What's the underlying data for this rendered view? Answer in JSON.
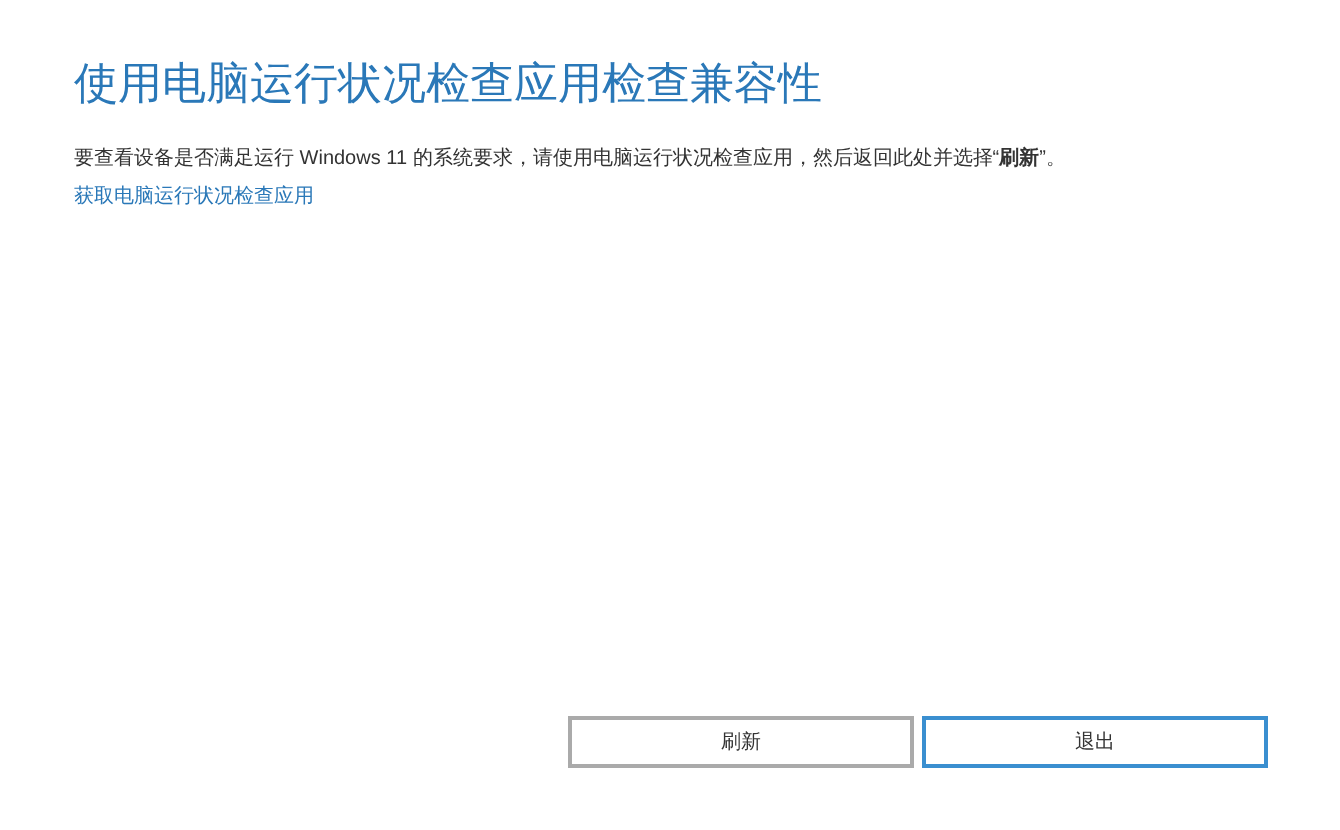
{
  "title": "使用电脑运行状况检查应用检查兼容性",
  "description": {
    "text": "要查看设备是否满足运行 Windows 11 的系统要求，请使用电脑运行状况检查应用，然后返回此处并选择“**刷新**”。",
    "link": "获取电脑运行状况检查应用"
  },
  "buttons": [
    {
      "label": "刷新",
      "focused": false
    },
    {
      "label": "退出",
      "focused": true
    }
  ]
}
